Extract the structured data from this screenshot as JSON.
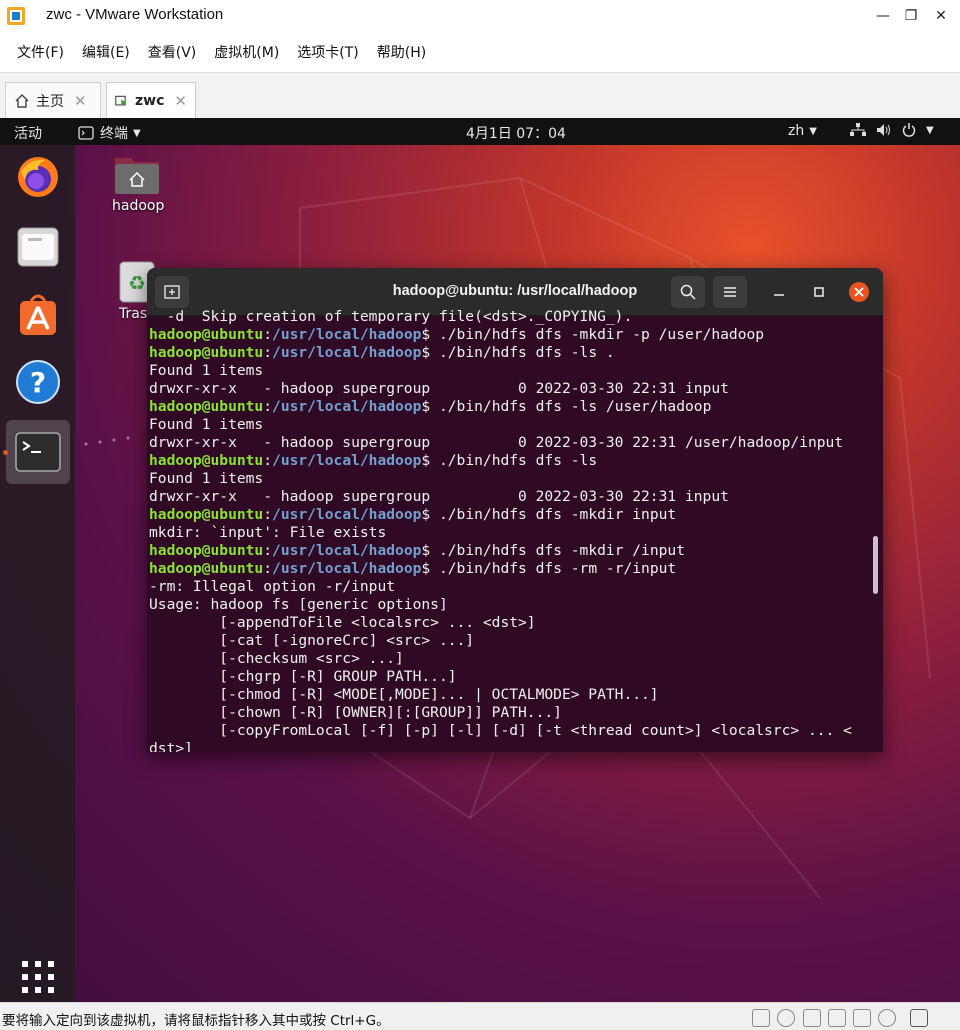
{
  "window": {
    "title": "zwc - VMware Workstation",
    "minimize": "—",
    "maximize": "❐",
    "close": "✕"
  },
  "menu": [
    "文件(F)",
    "编辑(E)",
    "查看(V)",
    "虚拟机(M)",
    "选项卡(T)",
    "帮助(H)"
  ],
  "tabs": [
    {
      "label": "主页",
      "close": "✕"
    },
    {
      "label": "zwc",
      "close": "✕"
    }
  ],
  "topbar": {
    "activities": "活动",
    "app_menu": "终端",
    "clock": "4月1日  07：04",
    "input_method": "zh"
  },
  "desktop": {
    "home_label": "hadoop",
    "trash_label": "Trash"
  },
  "terminal": {
    "title": "hadoop@ubuntu: /usr/local/hadoop",
    "lines": [
      {
        "t": "  -d  Skip creation of temporary file(<dst>._COPYING_)."
      },
      {
        "u": "hadoop@ubuntu",
        "p": "/usr/local/hadoop",
        "c": "$ ./bin/hdfs dfs -mkdir -p /user/hadoop"
      },
      {
        "u": "hadoop@ubuntu",
        "p": "/usr/local/hadoop",
        "c": "$ ./bin/hdfs dfs -ls ."
      },
      {
        "t": "Found 1 items"
      },
      {
        "t": "drwxr-xr-x   - hadoop supergroup          0 2022-03-30 22:31 input"
      },
      {
        "u": "hadoop@ubuntu",
        "p": "/usr/local/hadoop",
        "c": "$ ./bin/hdfs dfs -ls /user/hadoop"
      },
      {
        "t": "Found 1 items"
      },
      {
        "t": "drwxr-xr-x   - hadoop supergroup          0 2022-03-30 22:31 /user/hadoop/input"
      },
      {
        "u": "hadoop@ubuntu",
        "p": "/usr/local/hadoop",
        "c": "$ ./bin/hdfs dfs -ls"
      },
      {
        "t": "Found 1 items"
      },
      {
        "t": "drwxr-xr-x   - hadoop supergroup          0 2022-03-30 22:31 input"
      },
      {
        "u": "hadoop@ubuntu",
        "p": "/usr/local/hadoop",
        "c": "$ ./bin/hdfs dfs -mkdir input"
      },
      {
        "t": "mkdir: `input': File exists"
      },
      {
        "u": "hadoop@ubuntu",
        "p": "/usr/local/hadoop",
        "c": "$ ./bin/hdfs dfs -mkdir /input"
      },
      {
        "u": "hadoop@ubuntu",
        "p": "/usr/local/hadoop",
        "c": "$ ./bin/hdfs dfs -rm -r/input"
      },
      {
        "t": "-rm: Illegal option -r/input"
      },
      {
        "t": "Usage: hadoop fs [generic options]"
      },
      {
        "t": "        [-appendToFile <localsrc> ... <dst>]"
      },
      {
        "t": "        [-cat [-ignoreCrc] <src> ...]"
      },
      {
        "t": "        [-checksum <src> ...]"
      },
      {
        "t": "        [-chgrp [-R] GROUP PATH...]"
      },
      {
        "t": "        [-chmod [-R] <MODE[,MODE]... | OCTALMODE> PATH...]"
      },
      {
        "t": "        [-chown [-R] [OWNER][:[GROUP]] PATH...]"
      },
      {
        "t": "        [-copyFromLocal [-f] [-p] [-l] [-d] [-t <thread count>] <localsrc> ... <"
      },
      {
        "t": "dst>]"
      }
    ]
  },
  "status": {
    "text": "要将输入定向到该虚拟机，请将鼠标指针移入其中或按 Ctrl+G。"
  }
}
